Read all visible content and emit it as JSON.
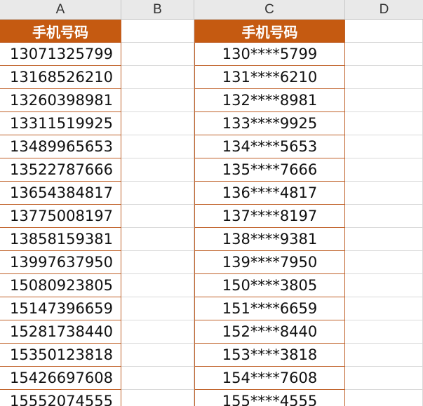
{
  "columns": [
    "A",
    "B",
    "C",
    "D"
  ],
  "table": {
    "header_left": "手机号码",
    "header_right": "手机号码",
    "rows": [
      {
        "original": "13071325799",
        "masked": "130****5799"
      },
      {
        "original": "13168526210",
        "masked": "131****6210"
      },
      {
        "original": "13260398981",
        "masked": "132****8981"
      },
      {
        "original": "13311519925",
        "masked": "133****9925"
      },
      {
        "original": "13489965653",
        "masked": "134****5653"
      },
      {
        "original": "13522787666",
        "masked": "135****7666"
      },
      {
        "original": "13654384817",
        "masked": "136****4817"
      },
      {
        "original": "13775008197",
        "masked": "137****8197"
      },
      {
        "original": "13858159381",
        "masked": "138****9381"
      },
      {
        "original": "13997637950",
        "masked": "139****7950"
      },
      {
        "original": "15080923805",
        "masked": "150****3805"
      },
      {
        "original": "15147396659",
        "masked": "151****6659"
      },
      {
        "original": "15281738440",
        "masked": "152****8440"
      },
      {
        "original": "15350123818",
        "masked": "153****3818"
      },
      {
        "original": "15426697608",
        "masked": "154****7608"
      },
      {
        "original": "15552074555",
        "masked": "155****4555"
      }
    ]
  },
  "colors": {
    "header_fill": "#c55a11",
    "header_text": "#ffffff",
    "border_accent": "#c0622a"
  }
}
